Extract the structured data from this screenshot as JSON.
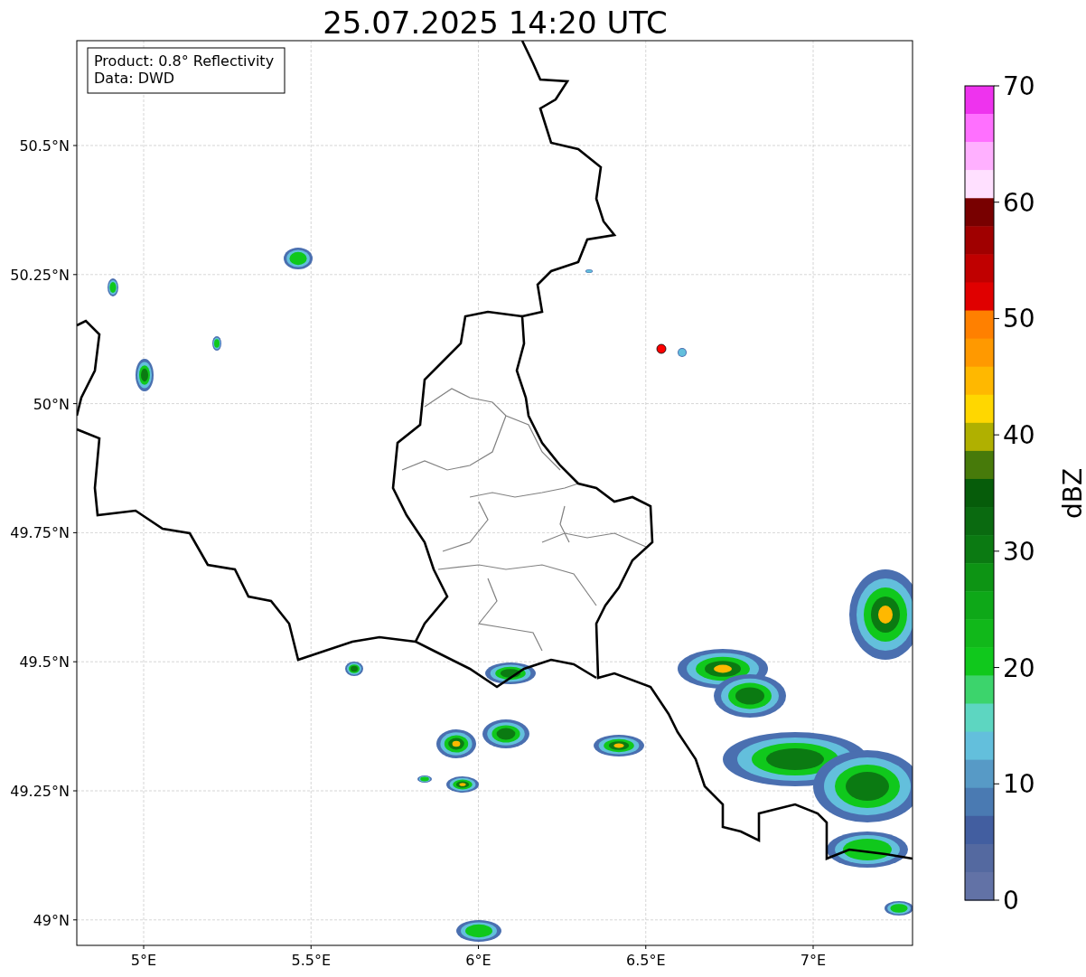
{
  "title": "25.07.2025 14:20 UTC",
  "annotation": [
    "Product: 0.8° Reflectivity",
    "Data: DWD"
  ],
  "map": {
    "lat_labels": [
      "50.5°N",
      "50.25°N",
      "50°N",
      "49.75°N",
      "49.5°N",
      "49.25°N",
      "49°N"
    ],
    "lon_labels": [
      "5°E",
      "5.5°E",
      "6°E",
      "6.5°E",
      "7°E"
    ]
  },
  "colorbar": {
    "label": "dBZ",
    "ticks": [
      "70",
      "60",
      "50",
      "40",
      "30",
      "20",
      "10",
      "0"
    ],
    "bins": [
      {
        "color": "#ee33ee"
      },
      {
        "color": "#ff70ff"
      },
      {
        "color": "#ffb0ff"
      },
      {
        "color": "#ffe0ff"
      },
      {
        "color": "#780000"
      },
      {
        "color": "#a00000"
      },
      {
        "color": "#c00000"
      },
      {
        "color": "#e00000"
      },
      {
        "color": "#ff8000"
      },
      {
        "color": "#ff9900"
      },
      {
        "color": "#ffb800"
      },
      {
        "color": "#ffd700"
      },
      {
        "color": "#b0b000"
      },
      {
        "color": "#477a0a"
      },
      {
        "color": "#065c0a"
      },
      {
        "color": "#0a6a10"
      },
      {
        "color": "#0b7a12"
      },
      {
        "color": "#0d9414"
      },
      {
        "color": "#0ea818"
      },
      {
        "color": "#11b81a"
      },
      {
        "color": "#10c81c"
      },
      {
        "color": "#3cd46c"
      },
      {
        "color": "#5dd6c1"
      },
      {
        "color": "#63bfdc"
      },
      {
        "color": "#579ac6"
      },
      {
        "color": "#4a7ab2"
      },
      {
        "color": "#425ea0"
      },
      {
        "color": "#5469a0"
      },
      {
        "color": "#6272a6"
      }
    ]
  }
}
